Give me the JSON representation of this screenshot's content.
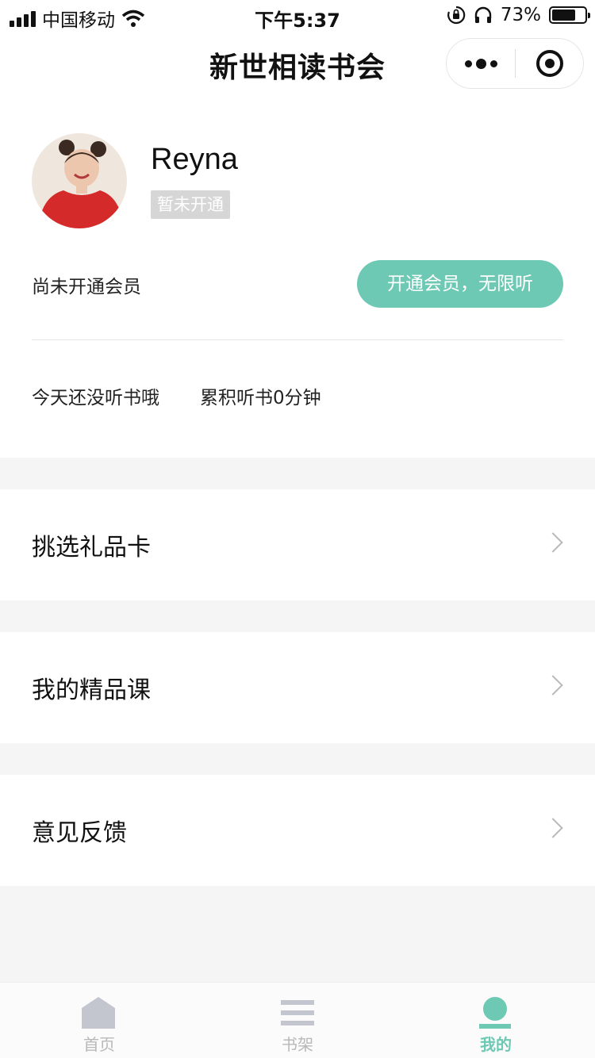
{
  "status_bar": {
    "carrier": "中国移动",
    "time": "下午5:37",
    "battery": "73%",
    "battery_level": 0.73,
    "icons": [
      "signal-icon",
      "wifi-icon",
      "rotation-lock-icon",
      "headphones-icon",
      "battery-icon"
    ]
  },
  "nav": {
    "title": "新世相读书会",
    "more_icon": "more-dots-icon",
    "close_icon": "target-circle-icon"
  },
  "profile": {
    "username": "Reyna",
    "badge": "暂未开通",
    "member_status": "尚未开通会员",
    "join_label": "开通会员，无限听",
    "listen_today": "今天还没听书哦",
    "listen_total": "累积听书0分钟"
  },
  "menu": {
    "items": [
      {
        "label": "挑选礼品卡"
      },
      {
        "label": "我的精品课"
      },
      {
        "label": "意见反馈"
      }
    ]
  },
  "tabbar": {
    "tabs": [
      {
        "label": "首页",
        "icon": "home-icon",
        "active": false
      },
      {
        "label": "书架",
        "icon": "bookshelf-icon",
        "active": false
      },
      {
        "label": "我的",
        "icon": "profile-icon",
        "active": true
      }
    ]
  },
  "colors": {
    "accent": "#6dc9b4",
    "inactive_icon": "#c3c6cf",
    "section_gap": "#f5f5f5"
  }
}
